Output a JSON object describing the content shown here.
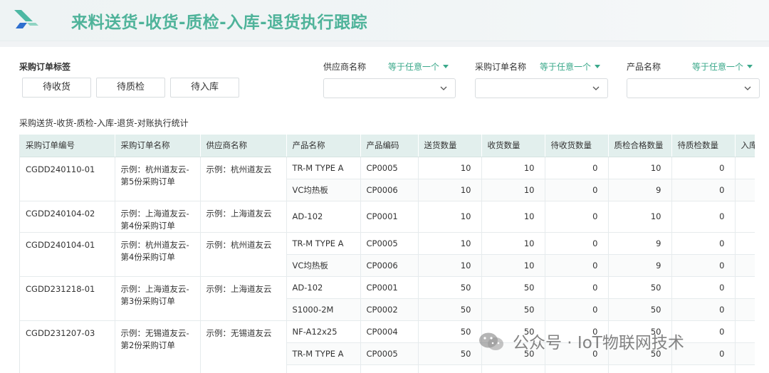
{
  "page_title": "来料送货-收货-质检-入库-退货执行跟踪",
  "filters": {
    "tag_label": "采购订单标签",
    "tag_buttons": [
      "待收货",
      "待质检",
      "待入库"
    ],
    "supplier": {
      "label": "供应商名称",
      "operator": "等于任意一个"
    },
    "po_name": {
      "label": "采购订单名称",
      "operator": "等于任意一个"
    },
    "product": {
      "label": "产品名称",
      "operator": "等于任意一个"
    }
  },
  "section_title": "采购送货-收货-质检-入库-退货-对账执行统计",
  "table": {
    "headers": [
      "采购订单编号",
      "采购订单名称",
      "供应商名称",
      "产品名称",
      "产品编码",
      "送货数量",
      "收货数量",
      "待收货数量",
      "质检合格数量",
      "待质检数量",
      "入库"
    ],
    "groups": [
      {
        "po_no": "CGDD240110-01",
        "po_name": "示例：杭州道友云-第5份采购订单",
        "supplier": "示例：杭州道友云",
        "items": [
          {
            "product": "TR-M TYPE A",
            "code": "CP0005",
            "delivered": "10",
            "received": "10",
            "pending_receive": "0",
            "qc_passed": "10",
            "pending_qc": "0"
          },
          {
            "product": "VC均热板",
            "code": "CP0006",
            "delivered": "10",
            "received": "10",
            "pending_receive": "0",
            "qc_passed": "9",
            "pending_qc": "0"
          }
        ]
      },
      {
        "po_no": "CGDD240104-02",
        "po_name": "示例：上海道友云-第4份采购订单",
        "supplier": "示例：上海道友云",
        "items": [
          {
            "product": "AD-102",
            "code": "CP0001",
            "delivered": "10",
            "received": "10",
            "pending_receive": "0",
            "qc_passed": "10",
            "pending_qc": "0"
          }
        ]
      },
      {
        "po_no": "CGDD240104-01",
        "po_name": "示例：杭州道友云-第4份采购订单",
        "supplier": "示例：杭州道友云",
        "items": [
          {
            "product": "TR-M TYPE A",
            "code": "CP0005",
            "delivered": "10",
            "received": "10",
            "pending_receive": "0",
            "qc_passed": "9",
            "pending_qc": "0"
          },
          {
            "product": "VC均热板",
            "code": "CP0006",
            "delivered": "10",
            "received": "10",
            "pending_receive": "0",
            "qc_passed": "9",
            "pending_qc": "0"
          }
        ]
      },
      {
        "po_no": "CGDD231218-01",
        "po_name": "示例：上海道友云-第3份采购订单",
        "supplier": "示例：上海道友云",
        "items": [
          {
            "product": "AD-102",
            "code": "CP0001",
            "delivered": "50",
            "received": "50",
            "pending_receive": "0",
            "qc_passed": "50",
            "pending_qc": "0"
          },
          {
            "product": "S1000-2M",
            "code": "CP0002",
            "delivered": "50",
            "received": "50",
            "pending_receive": "0",
            "qc_passed": "50",
            "pending_qc": "0"
          }
        ]
      },
      {
        "po_no": "CGDD231207-03",
        "po_name": "示例：无锡道友云-第2份采购订单",
        "supplier": "示例：无锡道友云",
        "items": [
          {
            "product": "NF-A12x25",
            "code": "CP0004",
            "delivered": "50",
            "received": "50",
            "pending_receive": "0",
            "qc_passed": "50",
            "pending_qc": "0"
          },
          {
            "product": "TR-M TYPE A",
            "code": "CP0005",
            "delivered": "50",
            "received": "50",
            "pending_receive": "0",
            "qc_passed": "50",
            "pending_qc": "0"
          },
          {
            "product": "",
            "code": "",
            "delivered": "",
            "received": "",
            "pending_receive": "",
            "qc_passed": "",
            "pending_qc": ""
          }
        ]
      }
    ]
  },
  "watermark": "公众号 · IoT物联网技术",
  "colors": {
    "accent": "#3aa88a",
    "title": "#4fb39a",
    "header_bg": "#e2efed"
  }
}
